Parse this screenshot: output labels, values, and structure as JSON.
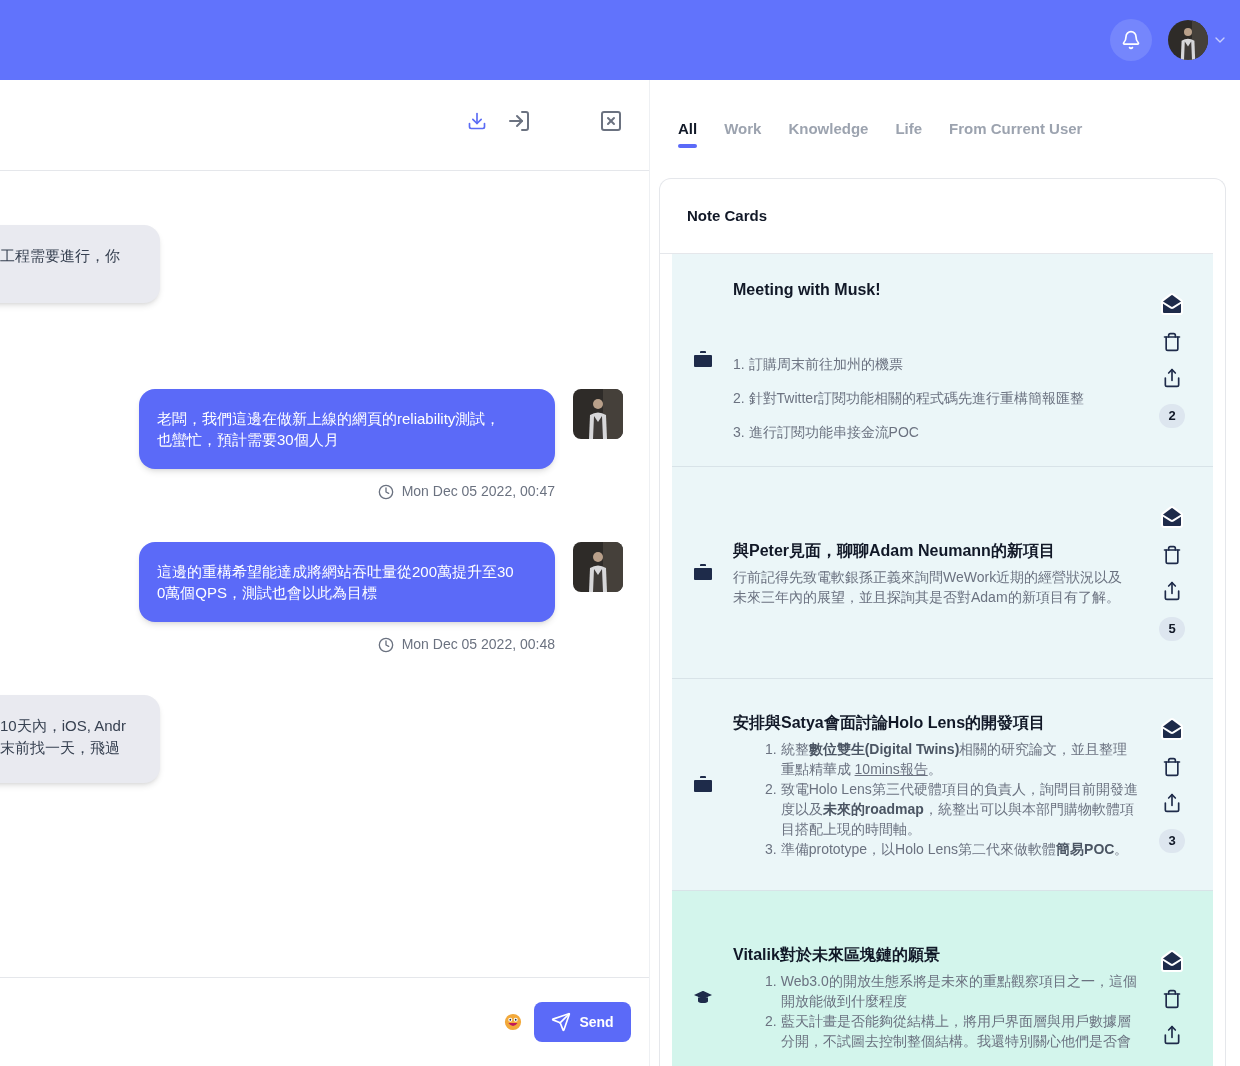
{
  "chat": {
    "messages": [
      {
        "kind": "incoming",
        "lines": [
          "工程需要進行，你"
        ]
      },
      {
        "kind": "outgoing",
        "lines": [
          "老闆，我們這邊在做新上線的網頁的reliability測試，",
          "也蠻忙，預計需要30個人月"
        ],
        "time": "Mon Dec 05 2022, 00:47"
      },
      {
        "kind": "outgoing",
        "lines": [
          "這邊的重構希望能達成將網站吞吐量從200萬提升至30",
          "0萬個QPS，測試也會以此為目標"
        ],
        "time": "Mon Dec 05 2022, 00:48"
      },
      {
        "kind": "incoming",
        "lines": [
          "10天內，iOS, Andr",
          "末前找一天，飛過"
        ]
      }
    ],
    "send_label": "Send"
  },
  "tabs": [
    {
      "label": "All",
      "selected": true
    },
    {
      "label": "Work",
      "selected": false
    },
    {
      "label": "Knowledge",
      "selected": false
    },
    {
      "label": "Life",
      "selected": false
    },
    {
      "label": "From Current User",
      "selected": false
    }
  ],
  "notes": {
    "title": "Note Cards",
    "cards": [
      {
        "kind": "work",
        "title": "Meeting with Musk!",
        "items": [
          {
            "kind": "line",
            "text": "1. 訂購周末前往加州的機票"
          },
          {
            "kind": "line",
            "text": "2. 針對Twitter訂閱功能相關的程式碼先進行重構簡報匯整"
          },
          {
            "kind": "line",
            "text": "3. 進行訂閱功能串接金流POC"
          }
        ],
        "count": "2"
      },
      {
        "kind": "work",
        "title": "與Peter見面，聊聊Adam Neumann的新項目",
        "items": [
          {
            "kind": "paragraph",
            "text": "行前記得先致電軟銀孫正義來詢問WeWork近期的經營狀況以及未來三年內的展望，並且探詢其是否對Adam的新項目有了解。"
          }
        ],
        "count": "5"
      },
      {
        "kind": "work",
        "title": "安排與Satya會面討論Holo Lens的開發項目",
        "items": [
          {
            "kind": "numbered",
            "number": "1.",
            "text": "統整**數位雙生(Digital Twins)**相關的研究論文，並且整理重點精華成 ",
            "link": "10mins報告",
            "after": "。"
          },
          {
            "kind": "numbered",
            "number": "2.",
            "text": "致電Holo Lens第三代硬體項目的負責人，詢問目前開發進度以及**未來的roadmap**，統整出可以與本部門購物軟體項目搭配上現的時間軸。"
          },
          {
            "kind": "numbered",
            "number": "3.",
            "text": "準備prototype，以Holo Lens第二代來做軟體**簡易POC**。"
          }
        ],
        "count": "3"
      },
      {
        "kind": "knowledge",
        "title": "Vitalik對於未來區塊鏈的願景",
        "items": [
          {
            "kind": "numbered",
            "number": "1.",
            "text": "Web3.0的開放生態系將是未來的重點觀察項目之一，這個開放能做到什麼程度"
          },
          {
            "kind": "numbered",
            "number": "2.",
            "text": "藍天計畫是否能夠從結構上，將用戶界面層與用戶數據層分開，不試圖去控制整個結構。我還特別關心他們是否會"
          }
        ]
      }
    ]
  }
}
